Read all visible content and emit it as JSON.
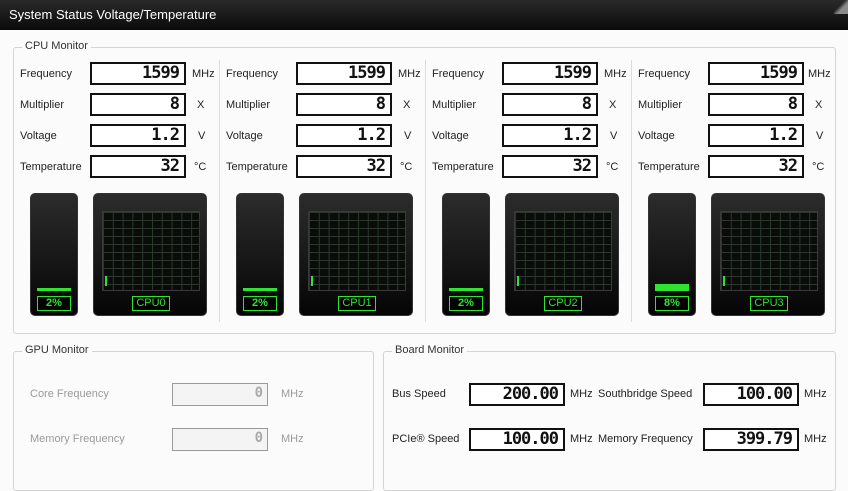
{
  "window": {
    "title": "System Status Voltage/Temperature"
  },
  "cpu_monitor": {
    "legend": "CPU Monitor",
    "row_labels": {
      "frequency": "Frequency",
      "multiplier": "Multiplier",
      "voltage": "Voltage",
      "temperature": "Temperature"
    },
    "units": {
      "frequency": "MHz",
      "multiplier": "X",
      "voltage": "V",
      "temperature": "°C"
    },
    "cpus": [
      {
        "name": "CPU0",
        "frequency": "1599",
        "multiplier": "8",
        "voltage": "1.2",
        "temperature": "32",
        "usage_label": "2%",
        "usage": 0.02
      },
      {
        "name": "CPU1",
        "frequency": "1599",
        "multiplier": "8",
        "voltage": "1.2",
        "temperature": "32",
        "usage_label": "2%",
        "usage": 0.02
      },
      {
        "name": "CPU2",
        "frequency": "1599",
        "multiplier": "8",
        "voltage": "1.2",
        "temperature": "32",
        "usage_label": "2%",
        "usage": 0.02
      },
      {
        "name": "CPU3",
        "frequency": "1599",
        "multiplier": "8",
        "voltage": "1.2",
        "temperature": "32",
        "usage_label": "8%",
        "usage": 0.08
      }
    ],
    "trace_color": "#2ee42e"
  },
  "gpu_monitor": {
    "legend": "GPU Monitor",
    "core_frequency_label": "Core Frequency",
    "core_frequency_value": "0",
    "core_frequency_unit": "MHz",
    "memory_frequency_label": "Memory Frequency",
    "memory_frequency_value": "0",
    "memory_frequency_unit": "MHz"
  },
  "board_monitor": {
    "legend": "Board Monitor",
    "bus_speed_label": "Bus Speed",
    "bus_speed_value": "200.00",
    "bus_speed_unit": "MHz",
    "southbridge_speed_label": "Southbridge Speed",
    "southbridge_speed_value": "100.00",
    "southbridge_speed_unit": "MHz",
    "pcie_label": "PCIe® Speed",
    "pcie_value": "100.00",
    "pcie_unit": "MHz",
    "memory_frequency_label": "Memory Frequency",
    "memory_frequency_value": "399.79",
    "memory_frequency_unit": "MHz"
  }
}
